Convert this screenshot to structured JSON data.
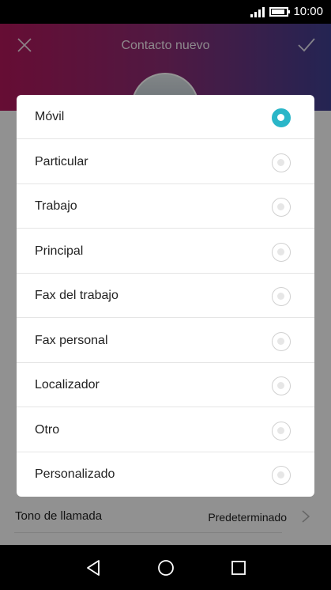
{
  "status_bar": {
    "time": "10:00",
    "battery_level": 0.85
  },
  "header": {
    "title": "Contacto nuevo",
    "close_icon": "close-icon",
    "confirm_icon": "check-icon"
  },
  "background_form": {
    "ringtone_label": "Tono de llamada",
    "ringtone_value": "Predeterminado"
  },
  "dialog": {
    "options": [
      {
        "label": "Móvil",
        "selected": true
      },
      {
        "label": "Particular",
        "selected": false
      },
      {
        "label": "Trabajo",
        "selected": false
      },
      {
        "label": "Principal",
        "selected": false
      },
      {
        "label": "Fax del trabajo",
        "selected": false
      },
      {
        "label": "Fax personal",
        "selected": false
      },
      {
        "label": "Localizador",
        "selected": false
      },
      {
        "label": "Otro",
        "selected": false
      },
      {
        "label": "Personalizado",
        "selected": false
      }
    ]
  },
  "nav": {
    "back_icon": "back-triangle-icon",
    "home_icon": "home-circle-icon",
    "recents_icon": "recents-square-icon"
  },
  "colors": {
    "accent": "#2ab6c8",
    "header_start": "#b0175a",
    "header_end": "#3f3f8f"
  }
}
